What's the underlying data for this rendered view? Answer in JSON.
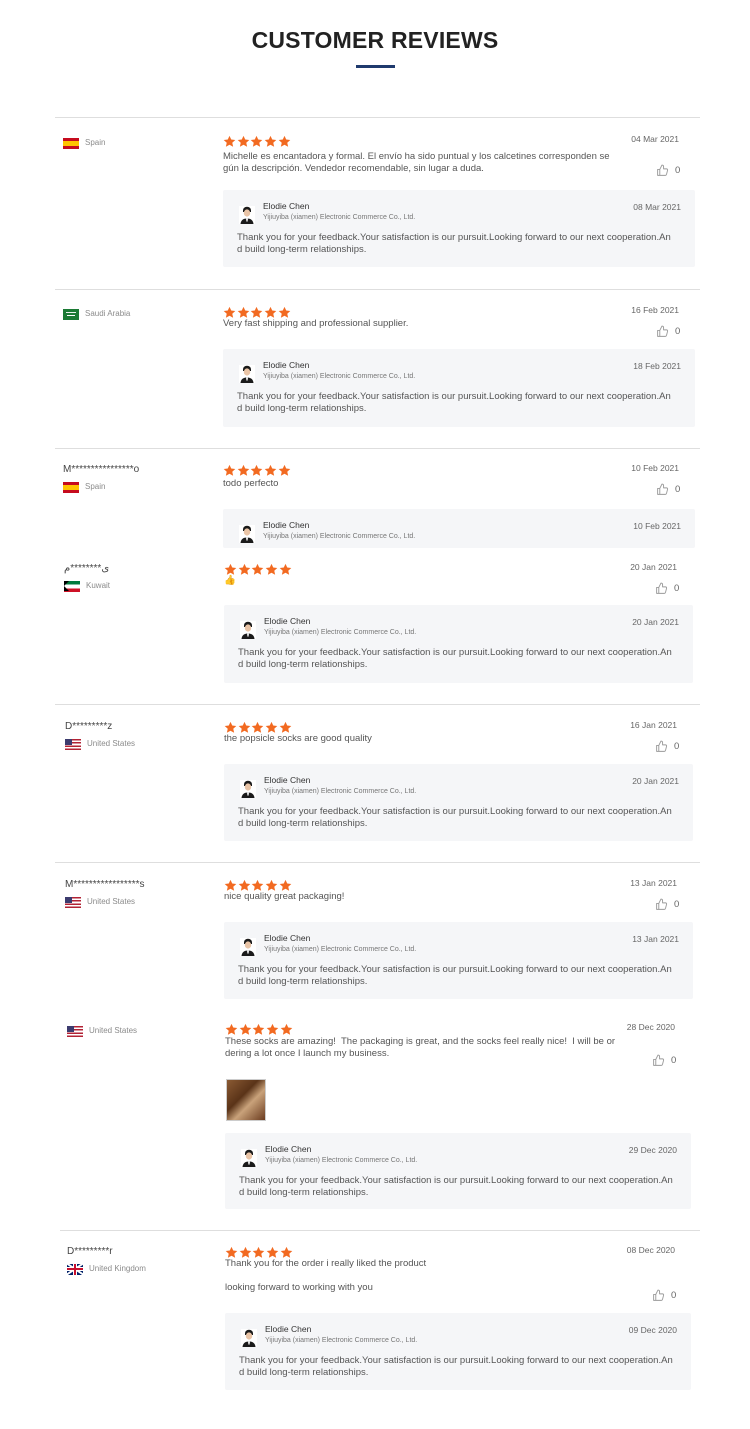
{
  "page": {
    "title": "CUSTOMER REVIEWS"
  },
  "colors": {
    "star": "#f26a21",
    "title_underline": "#1f3a6d",
    "reply_bg": "#f5f6f8"
  },
  "icons": {
    "star": "star-icon",
    "like": "thumbs-up-icon",
    "avatar": "person-avatar-icon",
    "flag": "country-flag-icon"
  },
  "reviews": [
    {
      "user": "",
      "country": "Spain",
      "flag": "spain",
      "rating": 5,
      "date": "04 Mar 2021",
      "text": "Michelle es encantadora y formal. El envío ha sido puntual y los calcetines corresponden se\ngún la descripción. Vendedor recomendable, sin lugar a duda.",
      "likes": "0",
      "reply": {
        "name": "Elodie Chen",
        "company": "Yijiuyiba (xiamen) Electronic Commerce Co., Ltd.",
        "date": "08 Mar 2021",
        "text": "Thank you for your feedback.Your satisfaction is our pursuit.Looking forward to our next cooperation.An\nd build long-term relationships."
      }
    },
    {
      "user": "",
      "country": "Saudi Arabia",
      "flag": "saudi",
      "rating": 5,
      "date": "16 Feb 2021",
      "text": "Very fast shipping and professional supplier.",
      "likes": "0",
      "reply": {
        "name": "Elodie Chen",
        "company": "Yijiuyiba (xiamen) Electronic Commerce Co., Ltd.",
        "date": "18 Feb 2021",
        "text": "Thank you for your feedback.Your satisfaction is our pursuit.Looking forward to our next cooperation.An\nd build long-term relationships."
      }
    },
    {
      "user": "M****************o",
      "country": "Spain",
      "flag": "spain",
      "rating": 5,
      "date": "10 Feb 2021",
      "text": "todo perfecto",
      "likes": "0",
      "reply": {
        "name": "Elodie Chen",
        "company": "Yijiuyiba (xiamen) Electronic Commerce Co., Ltd.",
        "date": "10 Feb 2021",
        "text": ""
      }
    },
    {
      "user": "ی********م",
      "country": "Kuwait",
      "flag": "kuwait",
      "rating": 5,
      "date": "20 Jan 2021",
      "text": "👍",
      "likes": "0",
      "reply": {
        "name": "Elodie Chen",
        "company": "Yijiuyiba (xiamen) Electronic Commerce Co., Ltd.",
        "date": "20 Jan 2021",
        "text": "Thank you for your feedback.Your satisfaction is our pursuit.Looking forward to our next cooperation.An\nd build long-term relationships."
      }
    },
    {
      "user": "D*********z",
      "country": "United States",
      "flag": "us",
      "rating": 5,
      "date": "16 Jan 2021",
      "text": "the popsicle socks are good quality",
      "likes": "0",
      "reply": {
        "name": "Elodie Chen",
        "company": "Yijiuyiba (xiamen) Electronic Commerce Co., Ltd.",
        "date": "20 Jan 2021",
        "text": "Thank you for your feedback.Your satisfaction is our pursuit.Looking forward to our next cooperation.An\nd build long-term relationships."
      }
    },
    {
      "user": "M*****************s",
      "country": "United States",
      "flag": "us",
      "rating": 5,
      "date": "13 Jan 2021",
      "text": "nice quality great packaging!",
      "likes": "0",
      "reply": {
        "name": "Elodie Chen",
        "company": "Yijiuyiba (xiamen) Electronic Commerce Co., Ltd.",
        "date": "13 Jan 2021",
        "text": "Thank you for your feedback.Your satisfaction is our pursuit.Looking forward to our next cooperation.An\nd build long-term relationships."
      }
    },
    {
      "user": "",
      "country": "United States",
      "flag": "us",
      "rating": 5,
      "date": "28 Dec 2020",
      "text": "These socks are amazing!  The packaging is great, and the socks feel really nice!  I will be or\ndering a lot once I launch my business.",
      "likes": "0",
      "reply": {
        "name": "Elodie Chen",
        "company": "Yijiuyiba (xiamen) Electronic Commerce Co., Ltd.",
        "date": "29 Dec 2020",
        "text": "Thank you for your feedback.Your satisfaction is our pursuit.Looking forward to our next cooperation.An\nd build long-term relationships."
      }
    },
    {
      "user": "D*********r",
      "country": "United Kingdom",
      "flag": "uk",
      "rating": 5,
      "date": "08 Dec 2020",
      "text": "Thank you for the order i really liked the product\n\nlooking forward to working with you",
      "likes": "0",
      "reply": {
        "name": "Elodie Chen",
        "company": "Yijiuyiba (xiamen) Electronic Commerce Co., Ltd.",
        "date": "09 Dec 2020",
        "text": "Thank you for your feedback.Your satisfaction is our pursuit.Looking forward to our next cooperation.An\nd build long-term relationships."
      }
    }
  ]
}
